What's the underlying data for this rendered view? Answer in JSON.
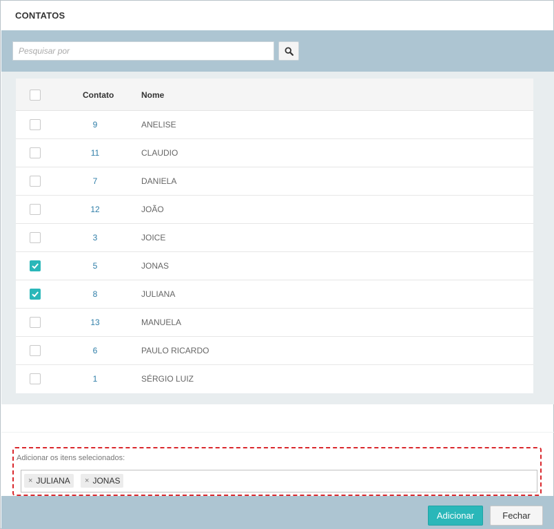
{
  "dialog": {
    "title": "CONTATOS"
  },
  "search": {
    "placeholder": "Pesquisar por",
    "value": ""
  },
  "table": {
    "headers": {
      "contato": "Contato",
      "nome": "Nome"
    },
    "rows": [
      {
        "contato": "9",
        "nome": "ANELISE",
        "checked": false
      },
      {
        "contato": "11",
        "nome": "CLAUDIO",
        "checked": false
      },
      {
        "contato": "7",
        "nome": "DANIELA",
        "checked": false
      },
      {
        "contato": "12",
        "nome": "JOÃO",
        "checked": false
      },
      {
        "contato": "3",
        "nome": "JOICE",
        "checked": false
      },
      {
        "contato": "5",
        "nome": "JONAS",
        "checked": true
      },
      {
        "contato": "8",
        "nome": "JULIANA",
        "checked": true
      },
      {
        "contato": "13",
        "nome": "MANUELA",
        "checked": false
      },
      {
        "contato": "6",
        "nome": "PAULO RICARDO",
        "checked": false
      },
      {
        "contato": "1",
        "nome": "SÉRGIO LUIZ",
        "checked": false
      }
    ]
  },
  "selected": {
    "label": "Adicionar os itens selecionados:",
    "tags": [
      "JULIANA",
      "JONAS"
    ],
    "remove_symbol": "×"
  },
  "footer": {
    "add_label": "Adicionar",
    "close_label": "Fechar"
  },
  "colors": {
    "accent": "#2ab7b9",
    "bar": "#adc5d2",
    "link": "#2f7ea8",
    "highlight": "#d9262b"
  }
}
